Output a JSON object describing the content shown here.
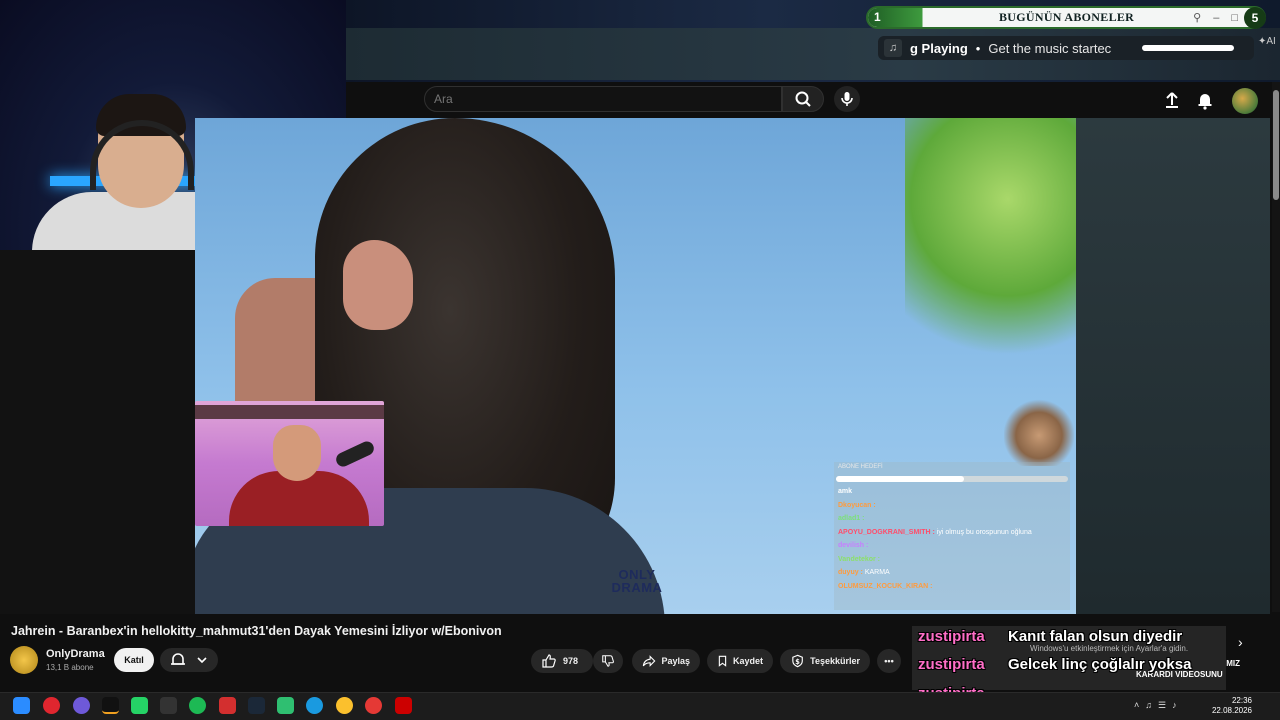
{
  "stream_overlay": {
    "subscriber_count": "1",
    "subscriber_title": "BUGÜNÜN ABONELER",
    "subscriber_end": "5",
    "now_playing_title": "g Playing",
    "now_playing_text": "Get the music startec",
    "ai_label": "AI",
    "watermark": "ONLY DRAMA"
  },
  "youtube_header": {
    "search_placeholder": "Ara"
  },
  "chat": {
    "title": "ABONE HEDEFİ",
    "progress": 0.55,
    "lines": [
      {
        "name": "amk",
        "name_color": "#ffffff",
        "text": ""
      },
      {
        "name": "Dkoyucan :",
        "name_color": "#ff9b3d",
        "text": ""
      },
      {
        "name": "adlad1 :",
        "name_color": "#7de07a",
        "text": ""
      },
      {
        "name": "APOYU_DOGKRANI_SMITH :",
        "name_color": "#ff4d6b",
        "text": "iyi olmuş bu orospunun oğluna"
      },
      {
        "name": "devilish :",
        "name_color": "#c77dff",
        "text": ""
      },
      {
        "name": "Vandetekor :",
        "name_color": "#8ce06a",
        "text": ""
      },
      {
        "name": "duyuy :",
        "name_color": "#ff9b3d",
        "text": "KARMA"
      },
      {
        "name": "OLUMSUZ_KOCUK_KIRAN :",
        "name_color": "#ff9b3d",
        "text": ""
      }
    ]
  },
  "video": {
    "title": "Jahrein - Baranbex'in hellokitty_mahmut31'den Dayak Yemesini İzliyor w/Ebonivon",
    "channel_name": "OnlyDrama",
    "subscribers": "13,1 B abone",
    "join_label": "Katıl",
    "like_count": "978",
    "share_label": "Paylaş",
    "save_label": "Kaydet",
    "thanks_label": "Teşekkürler"
  },
  "tts": {
    "user1": "zustipirta",
    "msg1": "Kanıt falan olsun diyedir",
    "user2": "zustipirta",
    "msg2": "Gelcek linç çoğlalır yoksa",
    "user3": "zustipirta"
  },
  "windows": {
    "activate_line1": "Windows'u etkinleştirmek için Ayarlar'a gidin.",
    "right_text_1": "MIZ",
    "right_text_2": "KARARDI VIDEOSUNU",
    "time": "22:36",
    "date": "22.08.2026"
  },
  "colors": {
    "accent_green": "#2b6b2b",
    "tts_pink": "#ff6ec7"
  }
}
